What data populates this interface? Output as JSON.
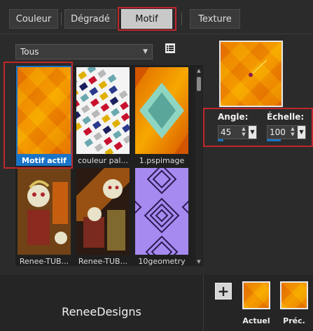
{
  "tabs": [
    {
      "label": "Couleur"
    },
    {
      "label": "Dégradé"
    },
    {
      "label": "Motif",
      "active": true
    },
    {
      "label": "Texture"
    }
  ],
  "category_dropdown": {
    "value": "Tous"
  },
  "patterns": [
    {
      "label": "Motif actif",
      "selected": true,
      "pattern": "orange-diamond"
    },
    {
      "label": "couleur pal...",
      "pattern": "color-blocks"
    },
    {
      "label": "1.pspimage",
      "pattern": "teal-orange-diamond"
    },
    {
      "label": "Renee-TUB...",
      "pattern": "clown-figure"
    },
    {
      "label": "Renee-TUB...",
      "pattern": "clown-figure-diagonal"
    },
    {
      "label": "10geometry",
      "pattern": "purple-geometry"
    }
  ],
  "controls": {
    "angle_label": "Angle:",
    "angle_value": "45",
    "scale_label": "Échelle:",
    "scale_value": "100"
  },
  "footer": {
    "brand": "ReneeDesigns",
    "add_label": "+",
    "current_label": "Actuel",
    "previous_label": "Préc."
  },
  "colors": {
    "accent_blue": "#1a74c7",
    "highlight_red": "#c1272d",
    "orange": "#f39200",
    "dark_orange": "#d45a00"
  }
}
